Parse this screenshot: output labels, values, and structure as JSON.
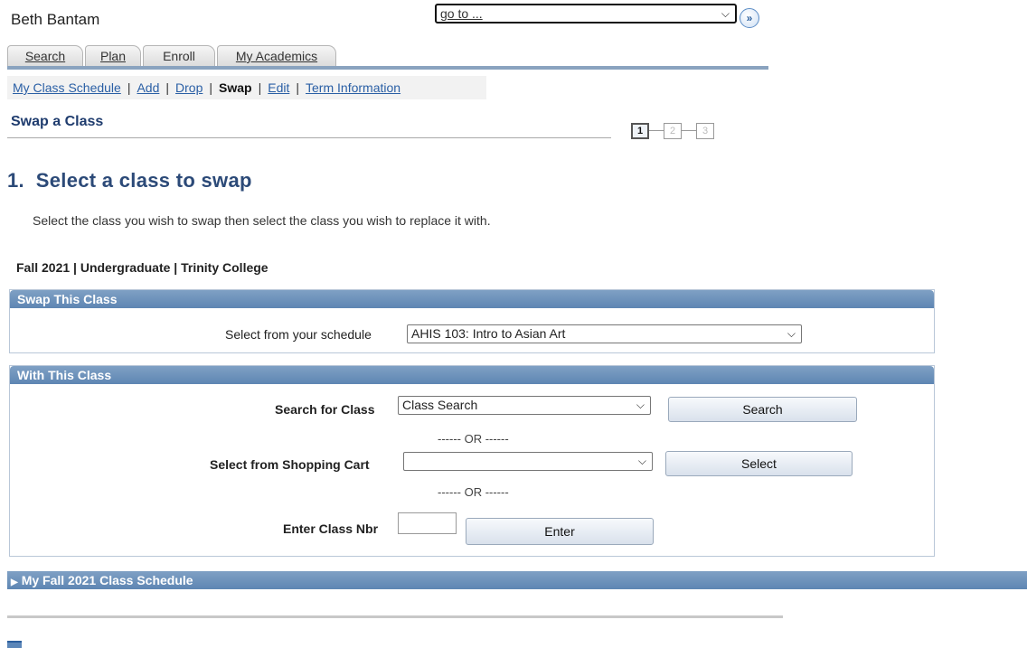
{
  "header": {
    "user_name": "Beth Bantam",
    "goto_value": "go to ...",
    "go_button": "»"
  },
  "tabs": [
    {
      "label": "Search"
    },
    {
      "label": "Plan"
    },
    {
      "label": "Enroll"
    },
    {
      "label": "My Academics"
    }
  ],
  "subnav": {
    "items": [
      "My Class Schedule",
      "Add",
      "Drop",
      "Swap",
      "Edit",
      "Term Information"
    ],
    "separator": "|",
    "current": "Swap"
  },
  "page": {
    "title": "Swap a Class",
    "steps": [
      "1",
      "2",
      "3"
    ],
    "heading": "1.  Select a class to swap",
    "instruction": "Select the class you wish to swap then select the class you wish to replace it with.",
    "term": "Fall 2021 | Undergraduate | Trinity College"
  },
  "swap_panel": {
    "title": "Swap This Class",
    "label": "Select from your schedule",
    "selected": "AHIS 103: Intro to Asian Art"
  },
  "with_panel": {
    "title": "With This Class",
    "search_label": "Search for Class",
    "search_selected": "Class Search",
    "search_button": "Search",
    "or_text": "------ OR ------",
    "cart_label": "Select from Shopping Cart",
    "cart_selected": "",
    "select_button": "Select",
    "nbr_label": "Enter Class Nbr",
    "nbr_value": "",
    "enter_button": "Enter"
  },
  "schedule_bar": {
    "title": "My Fall 2021 Class Schedule"
  },
  "colors": {
    "header_blue": "#5e86b3",
    "link": "#2a5fa5",
    "heading": "#2c4a78"
  }
}
